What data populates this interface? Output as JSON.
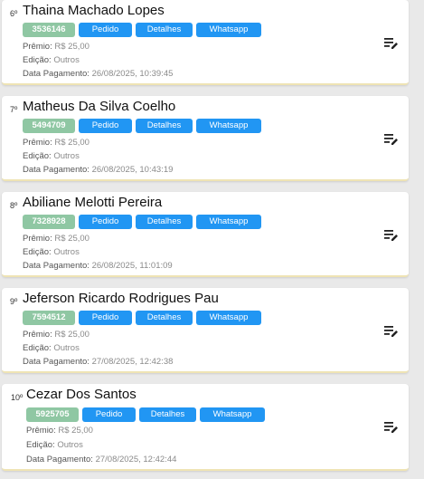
{
  "labels": {
    "premio": "Prêmio:",
    "edicao": "Edição:",
    "data_pagamento": "Data Pagamento:",
    "pedido": "Pedido",
    "detalhes": "Detalhes",
    "whatsapp": "Whatsapp"
  },
  "entries": [
    {
      "rank": "6º",
      "name": "Thaina Machado Lopes",
      "code": "3536146",
      "premio": "R$ 25,00",
      "edicao": "Outros",
      "data_pagamento": "26/08/2025, 10:39:45"
    },
    {
      "rank": "7º",
      "name": "Matheus Da Silva Coelho",
      "code": "5494709",
      "premio": "R$ 25,00",
      "edicao": "Outros",
      "data_pagamento": "26/08/2025, 10:43:19"
    },
    {
      "rank": "8º",
      "name": "Abiliane Melotti Pereira",
      "code": "7328928",
      "premio": "R$ 25,00",
      "edicao": "Outros",
      "data_pagamento": "26/08/2025, 11:01:09"
    },
    {
      "rank": "9º",
      "name": "Jeferson Ricardo Rodrigues Pau",
      "code": "7594512",
      "premio": "R$ 25,00",
      "edicao": "Outros",
      "data_pagamento": "27/08/2025, 12:42:38"
    },
    {
      "rank": "10º",
      "name": "Cezar Dos Santos",
      "code": "5925705",
      "premio": "R$ 25,00",
      "edicao": "Outros",
      "data_pagamento": "27/08/2025, 12:42:44"
    }
  ],
  "colors": {
    "code_badge": "#8fc7a3",
    "button": "#2196f3",
    "card_border": "#efe4b4"
  },
  "icons": {
    "edit": "edit-note-icon"
  }
}
